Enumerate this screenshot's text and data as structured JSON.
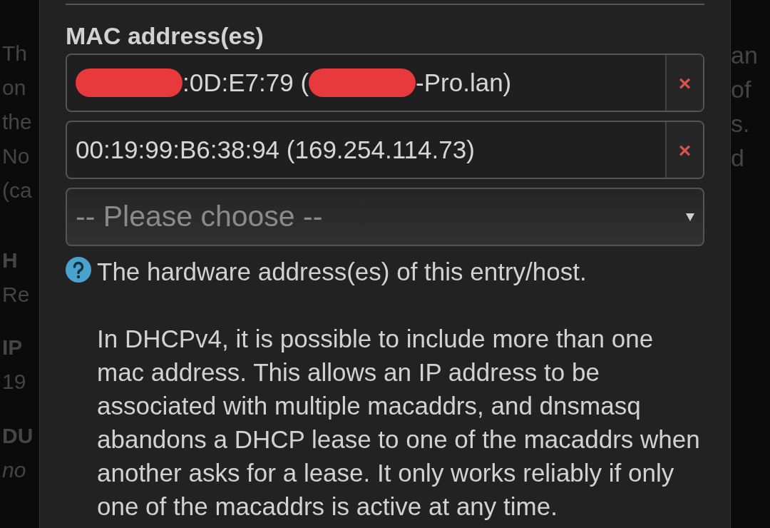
{
  "background": {
    "left_fragments": [
      {
        "text": "Th",
        "kind": "text"
      },
      {
        "text": "on",
        "kind": "text"
      },
      {
        "text": "the",
        "kind": "text"
      },
      {
        "text": "No",
        "kind": "text"
      },
      {
        "text": "(ca",
        "kind": "text"
      },
      {
        "text": "H",
        "kind": "heading"
      },
      {
        "text": "Re",
        "kind": "text"
      },
      {
        "text": "IP",
        "kind": "heading"
      },
      {
        "text": "19",
        "kind": "text"
      },
      {
        "text": "DU",
        "kind": "heading"
      },
      {
        "text": "no",
        "kind": "empty-value"
      }
    ],
    "right_fragments": [
      "an",
      "of",
      "s.",
      "d"
    ]
  },
  "field": {
    "label": "MAC address(es)",
    "entries": [
      {
        "segments": [
          {
            "kind": "redacted"
          },
          {
            "kind": "text",
            "text": ":0D:E7:79 ("
          },
          {
            "kind": "redacted"
          },
          {
            "kind": "text",
            "text": "-Pro.lan)"
          }
        ],
        "remove": "×"
      },
      {
        "segments": [
          {
            "kind": "text",
            "text": "00:19:99:B6:38:94 (169.254.114.73)"
          }
        ],
        "remove": "×"
      }
    ],
    "select": {
      "placeholder": "-- Please choose --"
    },
    "help": [
      "The hardware address(es) of this entry/host.",
      "In DHCPv4, it is possible to include more than one mac address. This allows an IP address to be associated with multiple macaddrs, and dnsmasq abandons a DHCP lease to one of the macaddrs when another asks for a lease. It only works reliably if only one of the macaddrs is active at any time."
    ]
  }
}
